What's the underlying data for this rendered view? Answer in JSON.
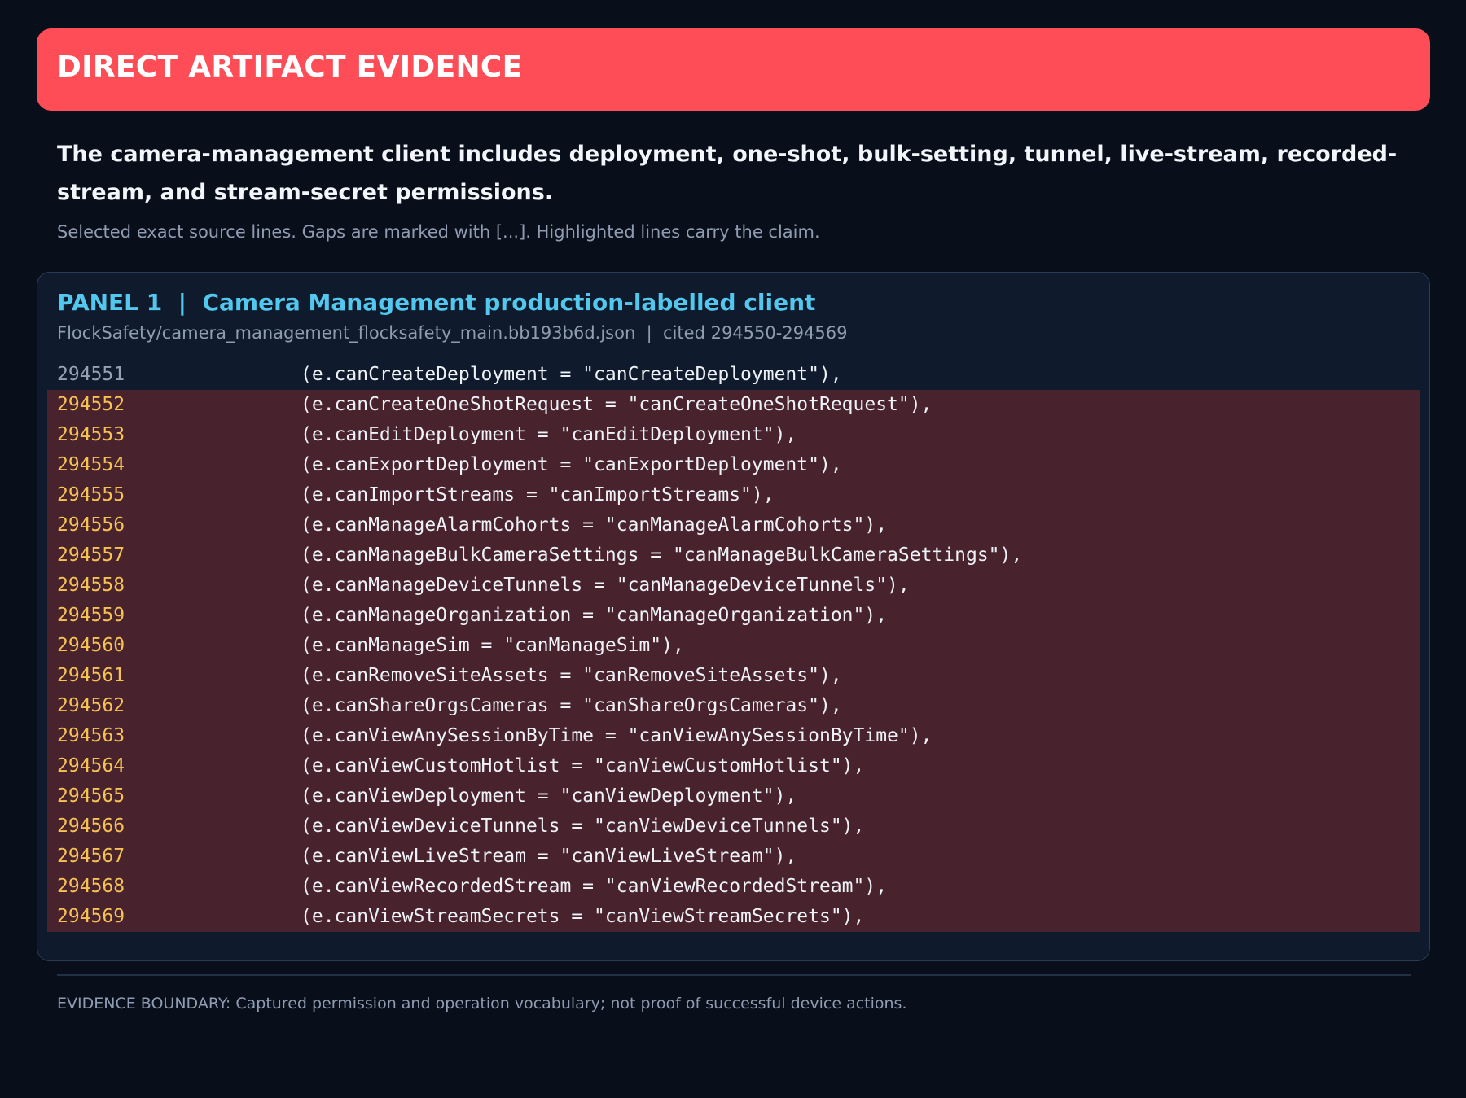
{
  "banner": {
    "title": "DIRECT ARTIFACT EVIDENCE"
  },
  "headline": "The camera-management client includes deployment, one-shot, bulk-setting, tunnel, live-stream, recorded-stream, and stream-secret permissions.",
  "subnote": "Selected exact source lines. Gaps are marked with [...]. Highlighted lines carry the claim.",
  "panel": {
    "title": "PANEL 1  |  Camera Management production-labelled client",
    "source": "FlockSafety/camera_management_flocksafety_main.bb193b6d.json  |  cited 294550-294569",
    "lines": [
      {
        "no": "294551",
        "code": "(e.canCreateDeployment = \"canCreateDeployment\"),",
        "highlighted": false
      },
      {
        "no": "294552",
        "code": "(e.canCreateOneShotRequest = \"canCreateOneShotRequest\"),",
        "highlighted": true
      },
      {
        "no": "294553",
        "code": "(e.canEditDeployment = \"canEditDeployment\"),",
        "highlighted": true
      },
      {
        "no": "294554",
        "code": "(e.canExportDeployment = \"canExportDeployment\"),",
        "highlighted": true
      },
      {
        "no": "294555",
        "code": "(e.canImportStreams = \"canImportStreams\"),",
        "highlighted": true
      },
      {
        "no": "294556",
        "code": "(e.canManageAlarmCohorts = \"canManageAlarmCohorts\"),",
        "highlighted": true
      },
      {
        "no": "294557",
        "code": "(e.canManageBulkCameraSettings = \"canManageBulkCameraSettings\"),",
        "highlighted": true
      },
      {
        "no": "294558",
        "code": "(e.canManageDeviceTunnels = \"canManageDeviceTunnels\"),",
        "highlighted": true
      },
      {
        "no": "294559",
        "code": "(e.canManageOrganization = \"canManageOrganization\"),",
        "highlighted": true
      },
      {
        "no": "294560",
        "code": "(e.canManageSim = \"canManageSim\"),",
        "highlighted": true
      },
      {
        "no": "294561",
        "code": "(e.canRemoveSiteAssets = \"canRemoveSiteAssets\"),",
        "highlighted": true
      },
      {
        "no": "294562",
        "code": "(e.canShareOrgsCameras = \"canShareOrgsCameras\"),",
        "highlighted": true
      },
      {
        "no": "294563",
        "code": "(e.canViewAnySessionByTime = \"canViewAnySessionByTime\"),",
        "highlighted": true
      },
      {
        "no": "294564",
        "code": "(e.canViewCustomHotlist = \"canViewCustomHotlist\"),",
        "highlighted": true
      },
      {
        "no": "294565",
        "code": "(e.canViewDeployment = \"canViewDeployment\"),",
        "highlighted": true
      },
      {
        "no": "294566",
        "code": "(e.canViewDeviceTunnels = \"canViewDeviceTunnels\"),",
        "highlighted": true
      },
      {
        "no": "294567",
        "code": "(e.canViewLiveStream = \"canViewLiveStream\"),",
        "highlighted": true
      },
      {
        "no": "294568",
        "code": "(e.canViewRecordedStream = \"canViewRecordedStream\"),",
        "highlighted": true
      },
      {
        "no": "294569",
        "code": "(e.canViewStreamSecrets = \"canViewStreamSecrets\"),",
        "highlighted": true
      }
    ]
  },
  "footer": {
    "note": "EVIDENCE BOUNDARY: Captured permission and operation vocabulary; not proof of successful device actions."
  },
  "colors": {
    "banner": "#ff4d57",
    "panel_title": "#52c8ee",
    "highlight_row": "#48222d",
    "highlight_line_number": "#f6c353"
  }
}
